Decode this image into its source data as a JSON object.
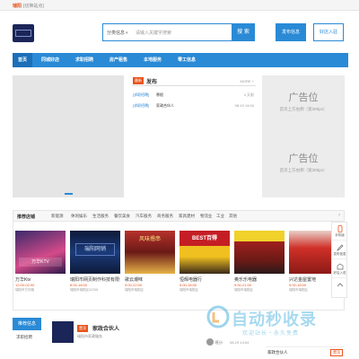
{
  "topbar": {
    "brand": "瑞阳",
    "link": "[切换站点]"
  },
  "search": {
    "category": "分类信息",
    "placeholder": "请输入关键字搜索",
    "button": "搜 索"
  },
  "header_buttons": {
    "publish": "发布信息",
    "join": "好店入驻"
  },
  "nav": {
    "items": [
      {
        "label": "首页",
        "active": true
      },
      {
        "label": "同城好店",
        "active": false
      },
      {
        "label": "求职招聘",
        "active": false
      },
      {
        "label": "房产租售",
        "active": false
      },
      {
        "label": "本地服务",
        "active": false
      },
      {
        "label": "零工信息",
        "active": false
      }
    ]
  },
  "publish": {
    "badge": "最新",
    "title": "发布",
    "more": "MORE +",
    "rows": [
      {
        "cat": "[求职招聘]",
        "name": "寒假",
        "time": "3 天前"
      },
      {
        "cat": "[求职招聘]",
        "name": "家政合伙人",
        "time": "08-19 14:04"
      }
    ]
  },
  "ads": [
    {
      "title": "广告位",
      "subtitle": "首页上方右侧（宽300px）"
    },
    {
      "title": "广告位",
      "subtitle": "首页上方右侧（宽300px）"
    }
  ],
  "stores": {
    "title": "推荐店铺",
    "categories": [
      "新能源",
      "休闲娱乐",
      "生活服务",
      "餐饮美食",
      "汽车服务",
      "商务服务",
      "家具建材",
      "物流业",
      "工业",
      "其他"
    ],
    "items": [
      {
        "name": "万华Ktv",
        "time": "12:00-02:00",
        "addr": "瑞阳市万华路",
        "colors": [
          "#d44a8a",
          "#3a2a6a"
        ],
        "sign": "万华KTV"
      },
      {
        "name": "瑞阳市网页制作科技有限公司",
        "time": "8:00-18:00",
        "addr": "瑞阳市瑞阳区SZ195",
        "colors": [
          "#1b3b7a",
          "#5a78c0"
        ],
        "sign": "瑞阳网销"
      },
      {
        "name": "歌云潮味",
        "time": "9:00-22:00",
        "addr": "瑞阳市瑞阳区",
        "colors": [
          "#b8322c",
          "#e6b348"
        ],
        "sign": "风味撸串"
      },
      {
        "name": "恒辉电器行",
        "time": "9:00-18:00",
        "addr": "瑞阳市瑞阳区",
        "colors": [
          "#c41e24",
          "#f0c020"
        ],
        "sign": "BEST百得"
      },
      {
        "name": "奥乐乐电器",
        "time": "9:00-21:00",
        "addr": "瑞阳市瑞阳区",
        "colors": [
          "#a0201e",
          "#f0d22a"
        ],
        "sign": ""
      },
      {
        "name": "兴达金屋置地",
        "time": "9:00-18:00",
        "addr": "瑞阳市瑞阳区",
        "colors": [
          "#d03028",
          "#e8d0c8"
        ],
        "sign": ""
      }
    ]
  },
  "sidebar": [
    {
      "label": "手机版",
      "icon": "phone-icon"
    },
    {
      "label": "发布信息",
      "icon": "edit-icon"
    },
    {
      "label": "好店入驻",
      "icon": "store-icon"
    },
    {
      "label": "",
      "icon": "top-icon"
    }
  ],
  "bottom": {
    "header": "推荐信息",
    "link": "求职招聘",
    "job_tag": "置顶",
    "job_title": "家政合伙人",
    "job_company": "瑞阳市家政服务"
  },
  "watermark": {
    "text": "自动秒收录",
    "sub": "欢迎站长・永久免费"
  },
  "mini": {
    "name": "旺小",
    "time": "08-19 14:04"
  },
  "family": {
    "name": "家政合伙人",
    "button": "置顶"
  },
  "colors": {
    "accent": "#2a8ad6",
    "brand": "#e8541c"
  }
}
